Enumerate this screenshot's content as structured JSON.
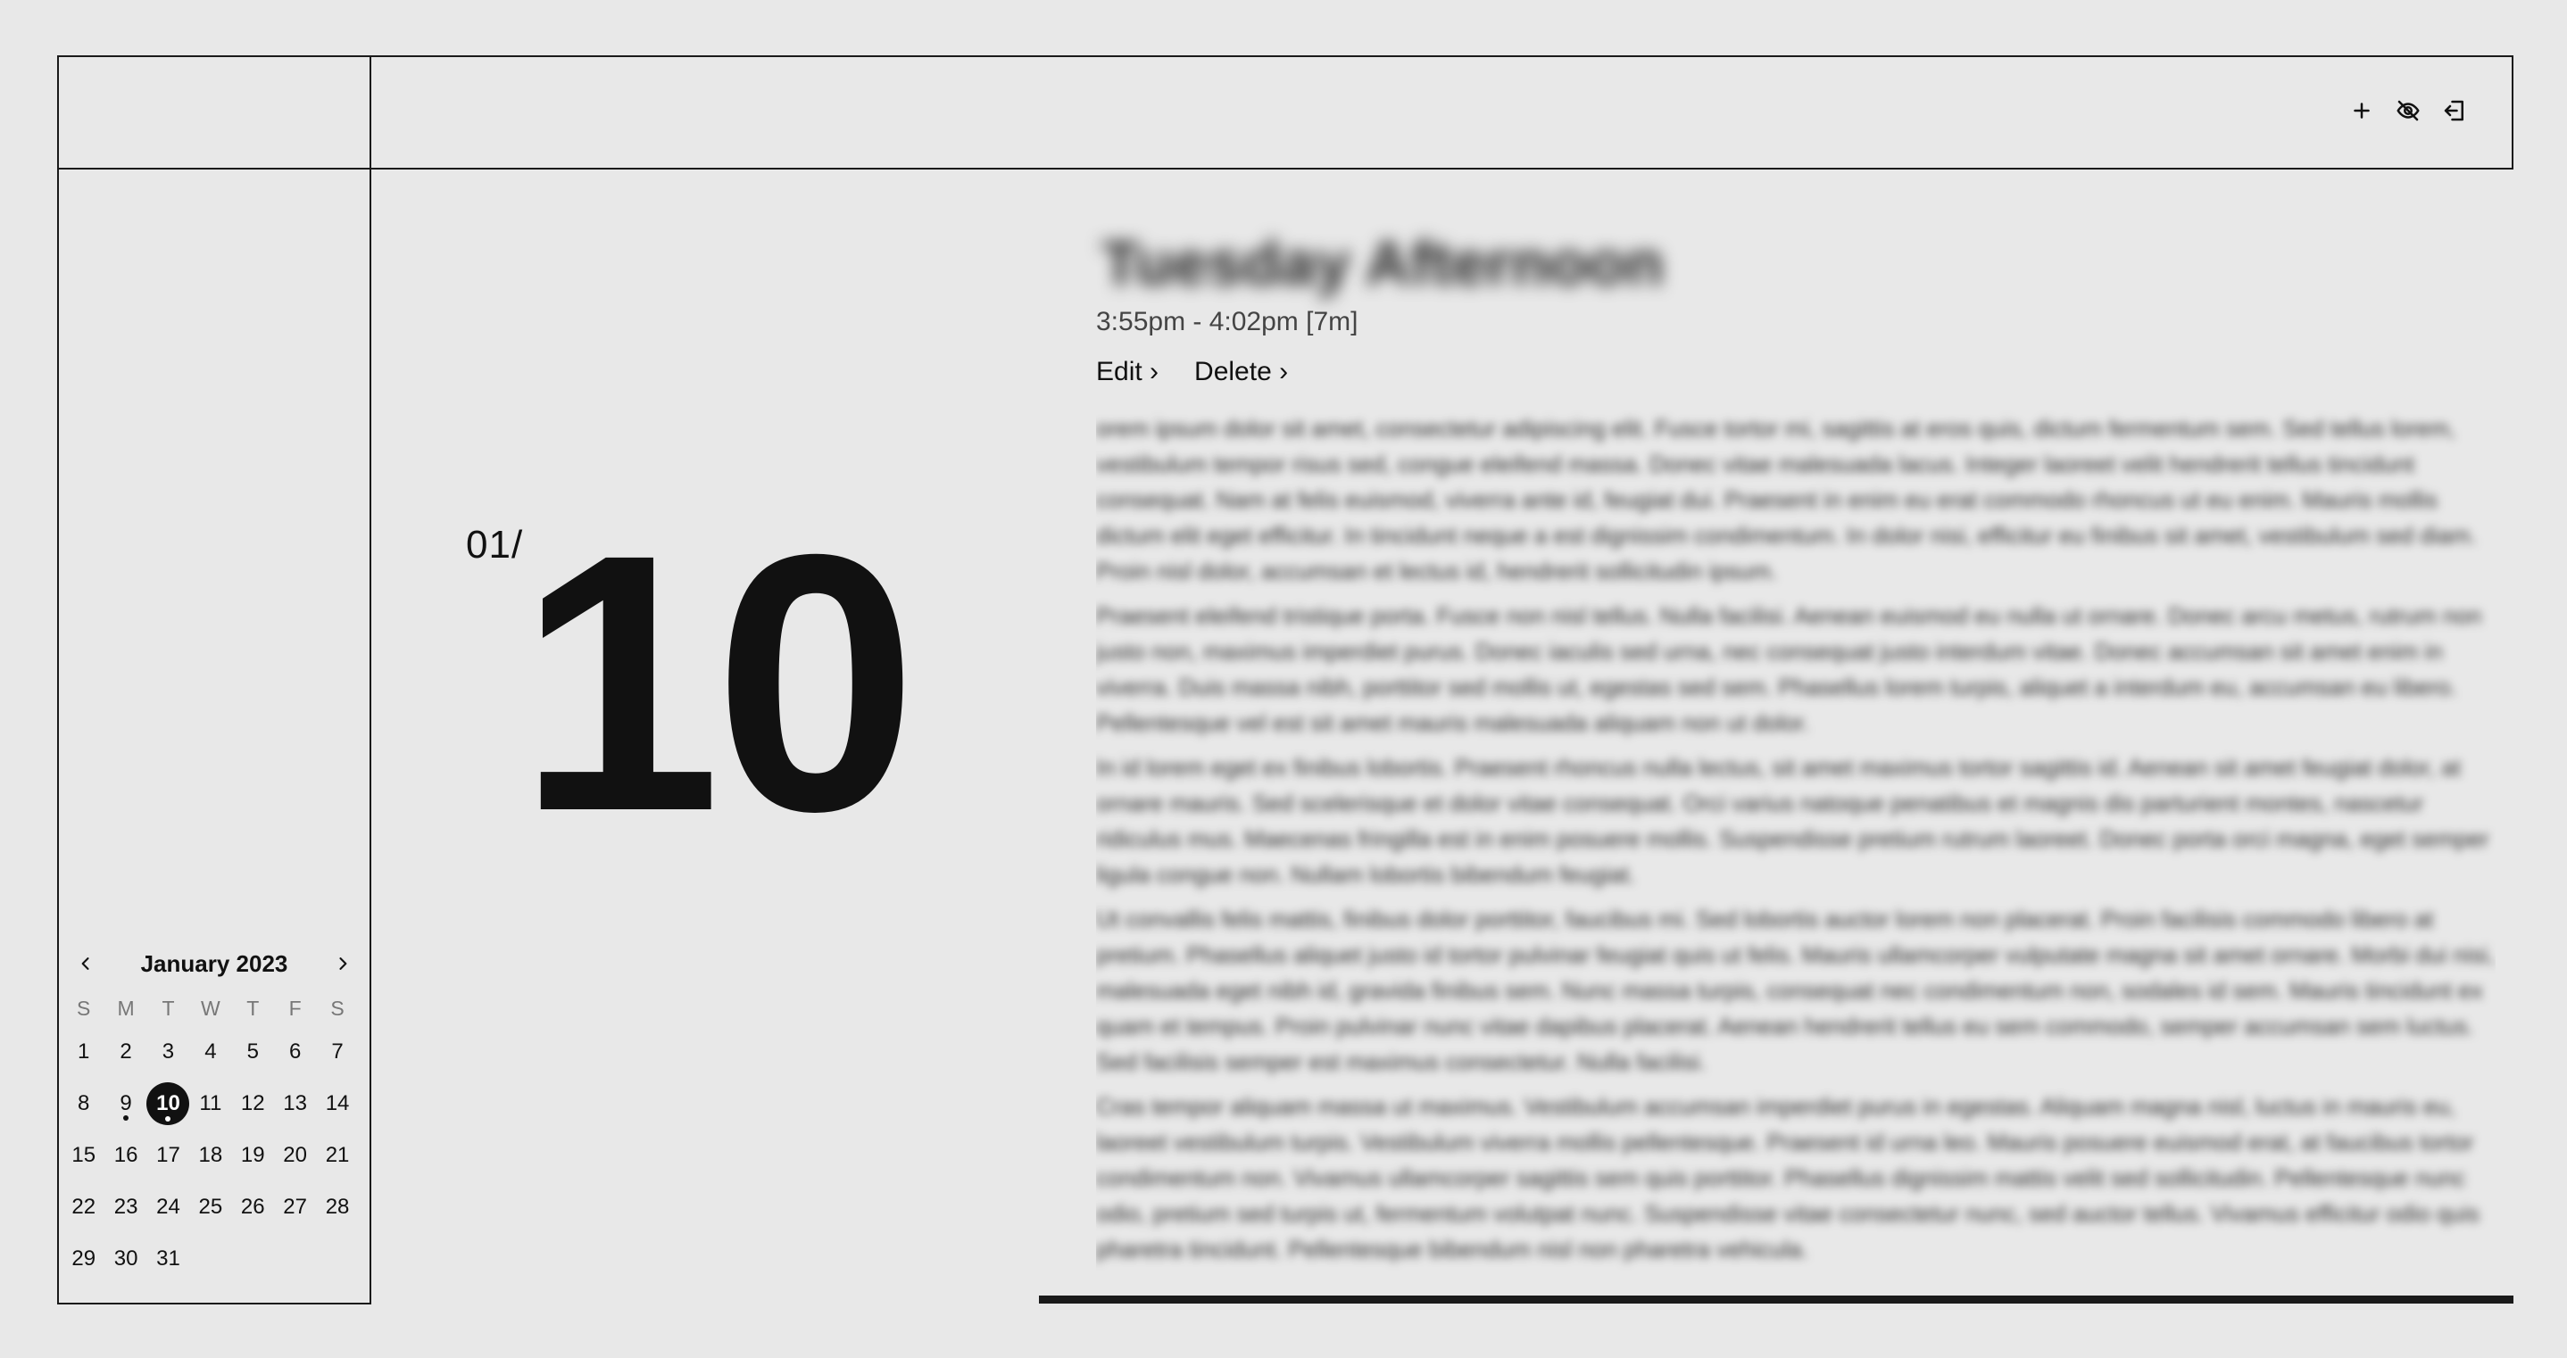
{
  "topbar": {
    "actions": [
      {
        "name": "add-button",
        "icon": "plus-icon"
      },
      {
        "name": "toggle-visibility-button",
        "icon": "eye-off-icon"
      },
      {
        "name": "logout-button",
        "icon": "logout-icon"
      }
    ]
  },
  "date_display": {
    "month": "01/",
    "day": "10"
  },
  "entry": {
    "title": "Tuesday Afternoon",
    "time": "3:55pm - 4:02pm [7m]",
    "edit_label": "Edit",
    "delete_label": "Delete",
    "paragraphs": [
      "orem ipsum dolor sit amet, consectetur adipiscing elit. Fusce tortor mi, sagittis at eros quis, dictum fermentum sem. Sed tellus lorem, vestibulum tempor risus sed, congue eleifend massa. Donec vitae malesuada lacus. Integer laoreet velit hendrerit tellus tincidunt consequat. Nam at felis euismod, viverra ante id, feugiat dui. Praesent in enim eu erat commodo rhoncus ut eu enim. Mauris mollis dictum elit eget efficitur. In tincidunt neque a est dignissim condimentum. In dolor nisi, efficitur eu finibus sit amet, vestibulum sed diam. Proin nisl dolor, accumsan et lectus id, hendrerit sollicitudin ipsum.",
      "Praesent eleifend tristique porta. Fusce non nisl tellus. Nulla facilisi. Aenean euismod eu nulla ut ornare. Donec arcu metus, rutrum non justo non, maximus imperdiet purus. Donec iaculis sed urna, nec consequat justo interdum vitae. Donec accumsan sit amet enim in viverra. Duis massa nibh, porttitor sed mollis ut, egestas sed sem. Phasellus lorem turpis, aliquet a interdum eu, accumsan eu libero. Pellentesque vel est sit amet mauris malesuada aliquam non ut dolor.",
      "In id lorem eget ex finibus lobortis. Praesent rhoncus nulla lectus, sit amet maximus tortor sagittis id. Aenean sit amet feugiat dolor, at ornare mauris. Sed scelerisque et dolor vitae consequat. Orci varius natoque penatibus et magnis dis parturient montes, nascetur ridiculus mus. Maecenas fringilla est in enim posuere mollis. Suspendisse pretium rutrum laoreet. Donec porta orci magna, eget semper ligula congue non. Nullam lobortis bibendum feugiat.",
      "Ut convallis felis mattis, finibus dolor porttitor, faucibus mi. Sed lobortis auctor lorem non placerat. Proin facilisis commodo libero at pretium. Phasellus aliquet justo id tortor pulvinar feugiat quis ut felis. Mauris ullamcorper vulputate magna sit amet ornare. Morbi dui nisi, malesuada eget nibh id, gravida finibus sem. Nunc massa turpis, consequat nec condimentum non, sodales id sem. Mauris tincidunt ex quam et tempus. Proin pulvinar nunc vitae dapibus placerat. Aenean hendrerit tellus eu sem commodo, semper accumsan sem luctus. Sed facilisis semper est maximus consectetur. Nulla facilisi.",
      "Cras tempor aliquam massa ut maximus. Vestibulum accumsan imperdiet purus in egestas. Aliquam magna nisl, luctus in mauris eu, laoreet vestibulum turpis. Vestibulum viverra mollis pellentesque. Praesent id urna leo. Mauris posuere euismod erat, at faucibus tortor condimentum non. Vivamus ullamcorper sagittis sem quis porttitor. Phasellus dignissim mattis velit sed sollicitudin. Pellentesque nunc odio, pretium sed turpis ut, fermentum volutpat nunc. Suspendisse vitae consectetur nunc, sed auctor tellus. Vivamus efficitur odio quis pharetra tincidunt. Pellentesque bibendum nisl non pharetra vehicula."
    ]
  },
  "calendar": {
    "title": "January 2023",
    "weekdays": [
      "S",
      "M",
      "T",
      "W",
      "T",
      "F",
      "S"
    ],
    "first_weekday_offset": 0,
    "days_in_month": 31,
    "selected_day": 10,
    "days_with_entries": [
      9,
      10
    ]
  }
}
